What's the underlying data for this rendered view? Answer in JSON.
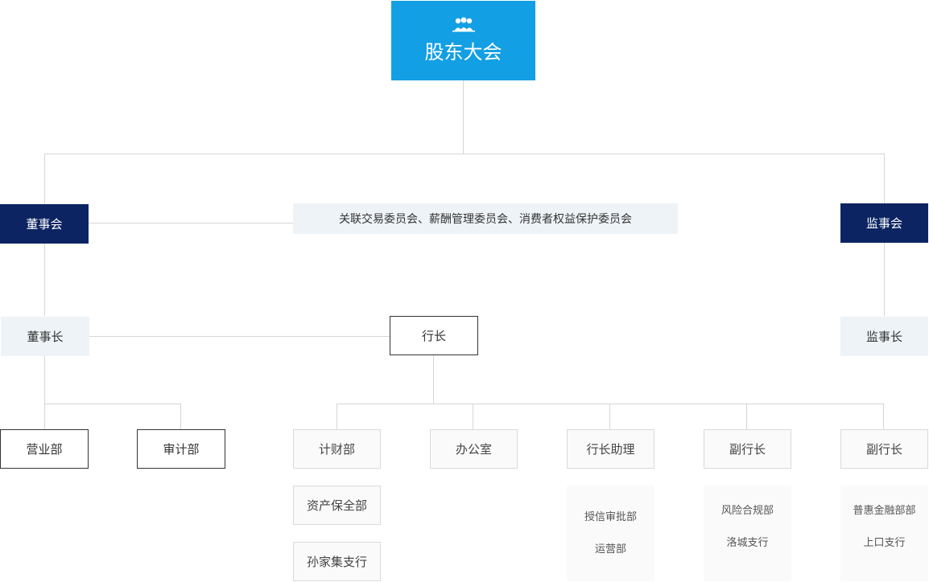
{
  "top": {
    "title": "股东大会",
    "icon": "people-group-icon"
  },
  "board": {
    "label": "董事会"
  },
  "committees": {
    "label": "关联交易委员会、薪酬管理委员会、消费者权益保护委员会"
  },
  "supervisory": {
    "label": "监事会"
  },
  "chairman": {
    "label": "董事长"
  },
  "president": {
    "label": "行长"
  },
  "chief_supervisor": {
    "label": "监事长"
  },
  "depts": {
    "business": "营业部",
    "audit": "审计部",
    "finance": "计财部",
    "office": "办公室",
    "assistant": "行长助理",
    "vp1": "副行长",
    "vp2": "副行长",
    "asset": "资产保全部",
    "sunjiaji": "孙家集支行"
  },
  "sub": {
    "assistant": [
      "授信审批部",
      "运营部"
    ],
    "vp1": [
      "风险合规部",
      "洛城支行"
    ],
    "vp2": [
      "普惠金融部部",
      "上口支行"
    ]
  },
  "colors": {
    "top": "#139fe3",
    "dark": "#0c2461",
    "light": "#eef3f7",
    "line": "#d6d6d6"
  }
}
